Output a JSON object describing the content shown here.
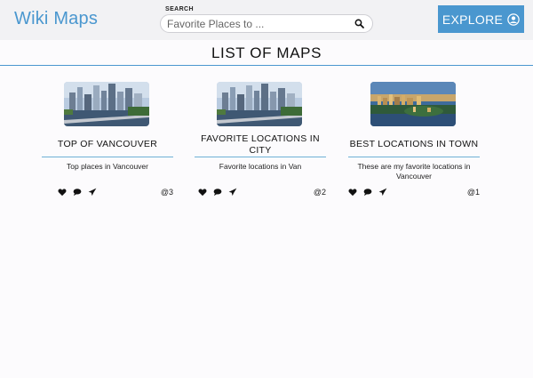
{
  "navbar": {
    "brand": "Wiki Maps",
    "search_label": "SEARCH",
    "search_placeholder": "Favorite Places to ...",
    "explore_label": "EXPLORE"
  },
  "page_title": "LIST OF MAPS",
  "maps": [
    {
      "title": "TOP OF VANCOUVER",
      "description": "Top places in Vancouver",
      "user": "@3"
    },
    {
      "title": "FAVORITE LOCATIONS IN CITY",
      "description": "Favorite locations in Van",
      "user": "@2"
    },
    {
      "title": "BEST LOCATIONS IN TOWN",
      "description": "These are my favorite locations in Vancouver",
      "user": "@1"
    }
  ],
  "colors": {
    "accent": "#4a97cf",
    "rule": "#6fb1d6",
    "navbar_bg": "#f2f2f4"
  },
  "icons": [
    "search-icon",
    "user-circle-icon",
    "heart-icon",
    "comment-icon",
    "share-icon"
  ]
}
